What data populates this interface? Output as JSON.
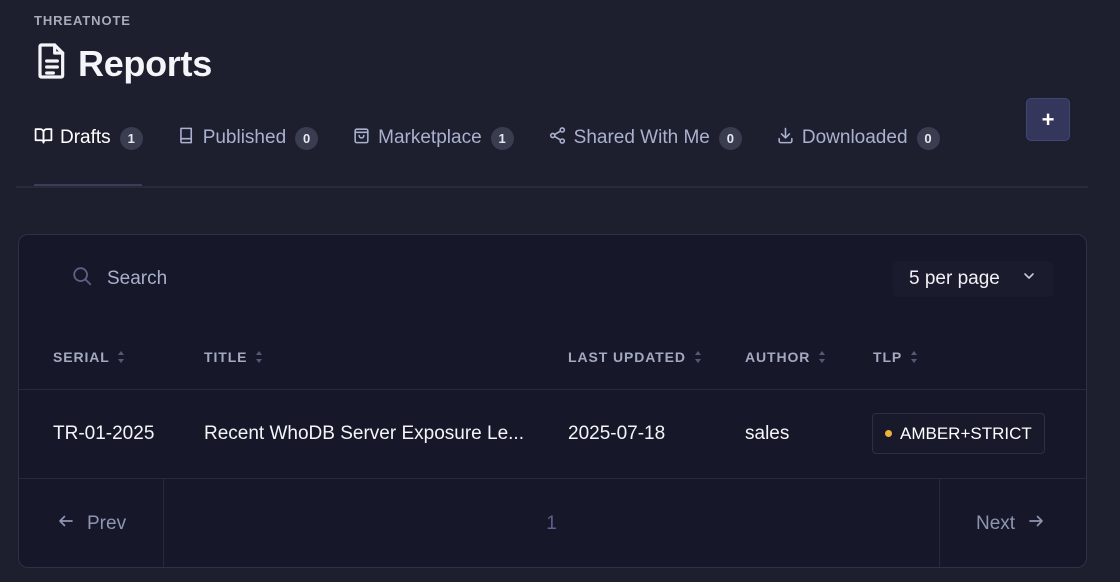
{
  "app": {
    "brand": "THREATNOTE"
  },
  "header": {
    "title": "Reports",
    "add_button": "+"
  },
  "tabs": [
    {
      "label": "Drafts",
      "count": "1",
      "icon": "book-open-icon",
      "active": true
    },
    {
      "label": "Published",
      "count": "0",
      "icon": "book-icon",
      "active": false
    },
    {
      "label": "Marketplace",
      "count": "1",
      "icon": "shopping-bag-icon",
      "active": false
    },
    {
      "label": "Shared With Me",
      "count": "0",
      "icon": "share-icon",
      "active": false
    },
    {
      "label": "Downloaded",
      "count": "0",
      "icon": "download-icon",
      "active": false
    }
  ],
  "search": {
    "placeholder": "Search",
    "value": ""
  },
  "per_page": {
    "selected": "5 per page"
  },
  "table": {
    "columns": [
      "SERIAL",
      "TITLE",
      "LAST UPDATED",
      "AUTHOR",
      "TLP"
    ],
    "rows": [
      {
        "serial": "TR-01-2025",
        "title": "Recent WhoDB Server Exposure Le...",
        "last_updated": "2025-07-18",
        "author": "sales",
        "tlp": "AMBER+STRICT"
      }
    ]
  },
  "pagination": {
    "prev": "Prev",
    "current_page": "1",
    "next": "Next"
  },
  "colors": {
    "background": "#1d1f2f",
    "card": "#161829",
    "accent_button": "#34365c",
    "tlp_amber": "#f0b33a"
  }
}
